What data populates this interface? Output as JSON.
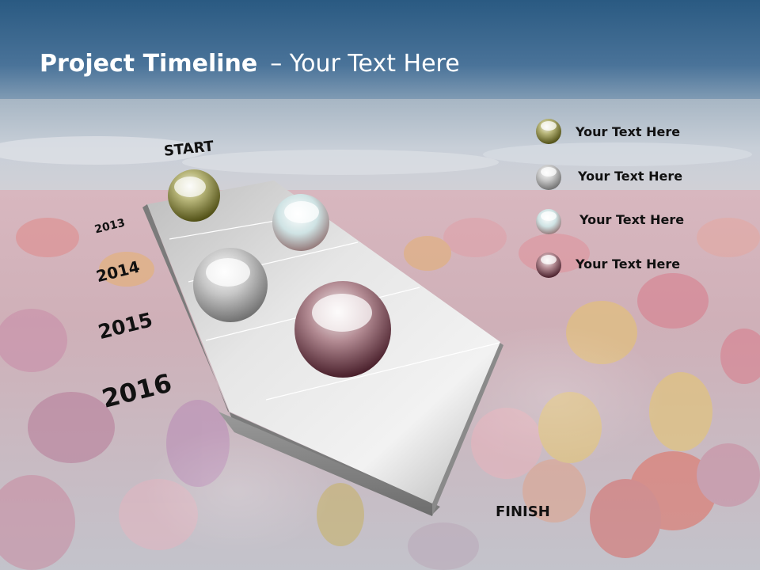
{
  "slide": {
    "title_bold": "Project Timeline",
    "title_rest": "– Your Text Here"
  },
  "timeline": {
    "start_label": "START",
    "finish_label": "FINISH",
    "years": [
      "2013",
      "2014",
      "2015",
      "2016"
    ]
  },
  "legend": [
    {
      "label": "Your  Text Here",
      "color": "#6b6a1f"
    },
    {
      "label": "Your  Text Here",
      "color": "#8a8a8a"
    },
    {
      "label": "Your  Text Here",
      "color": "#a9c7c9"
    },
    {
      "label": "Your  Text Here",
      "color": "#5a2a33"
    }
  ],
  "spheres": [
    {
      "name": "start-sphere",
      "color": "#6b6a1f"
    },
    {
      "name": "year-2013-sphere",
      "color": "#a9c7c9"
    },
    {
      "name": "year-2014-sphere",
      "color": "#8a8a8a"
    },
    {
      "name": "year-2015-sphere",
      "color": "#5a2a33"
    }
  ],
  "colors": {
    "sky_top": "#2e5f87",
    "sky_band": "#9cb0c0",
    "field_tint": "#c9c6d0",
    "ribbon": "#d4d4d4"
  }
}
